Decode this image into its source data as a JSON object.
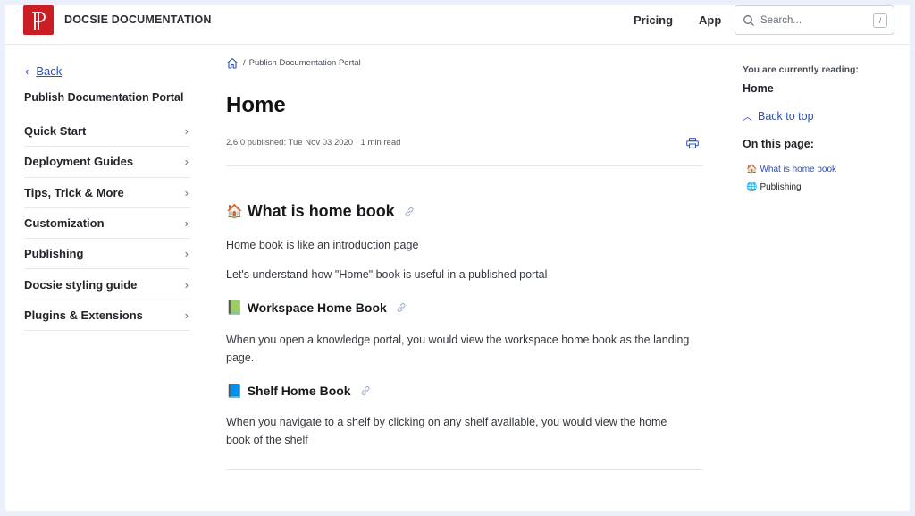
{
  "header": {
    "brand": "DOCSIE DOCUMENTATION",
    "nav": [
      "Pricing",
      "App"
    ],
    "search_placeholder": "Search...",
    "search_shortcut": "/"
  },
  "sidebar": {
    "back_label": "Back",
    "portal_title": "Publish Documentation Portal",
    "items": [
      {
        "label": "Quick Start"
      },
      {
        "label": "Deployment Guides"
      },
      {
        "label": "Tips, Trick & More"
      },
      {
        "label": "Customization"
      },
      {
        "label": "Publishing"
      },
      {
        "label": "Docsie styling guide"
      },
      {
        "label": "Plugins & Extensions"
      }
    ]
  },
  "main": {
    "breadcrumb": {
      "separator": "/",
      "current": "Publish Documentation Portal"
    },
    "title": "Home",
    "meta": "2.6.0 published: Tue Nov 03 2020 · 1 min read",
    "sections": {
      "what": {
        "emoji": "🏠",
        "heading": "What is home book",
        "paragraphs": [
          "Home book is like an introduction page",
          "Let's understand how \"Home\" book is useful in a published portal"
        ]
      },
      "workspace": {
        "emoji": "📗",
        "heading": "Workspace Home Book",
        "paragraph": "When you open a knowledge portal, you would view the workspace home book as the landing page."
      },
      "shelf": {
        "emoji": "📘",
        "heading": "Shelf Home Book",
        "paragraph": "When you navigate to a shelf by clicking on any shelf available, you would view the home book of the shelf"
      }
    }
  },
  "toc": {
    "reading_label": "You are currently reading:",
    "reading_value": "Home",
    "back_to_top": "Back to top",
    "on_this_page": "On this page:",
    "items": [
      {
        "emoji": "🏠",
        "label": "What is home book",
        "color": "#2d4fb8"
      },
      {
        "emoji": "🌐",
        "label": "Publishing",
        "color": "#22262b"
      }
    ]
  },
  "colors": {
    "brand_red": "#c81e24",
    "link_blue": "#2d4fb8",
    "page_bg": "#eaeffa"
  }
}
